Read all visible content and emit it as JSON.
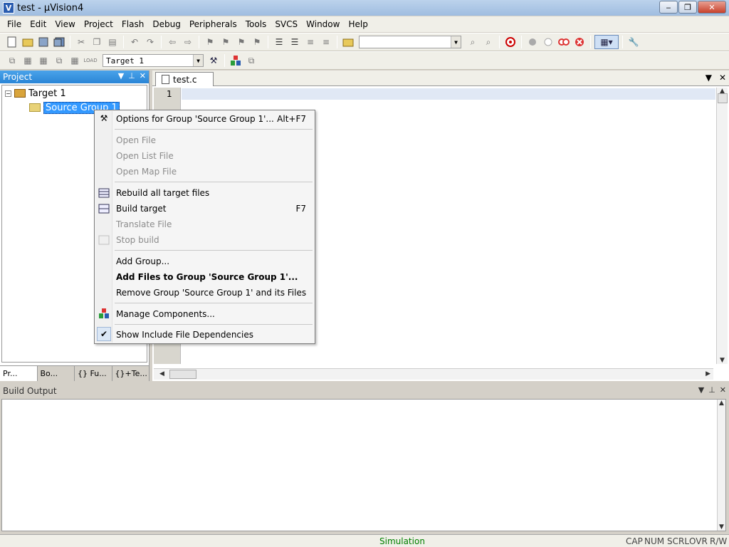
{
  "window": {
    "title": "test  - µVision4",
    "app_icon": "V",
    "minimize": "‒",
    "maximize": "❐",
    "close": "✕"
  },
  "menubar": [
    "File",
    "Edit",
    "View",
    "Project",
    "Flash",
    "Debug",
    "Peripherals",
    "Tools",
    "SVCS",
    "Window",
    "Help"
  ],
  "toolbar2": {
    "target_combo": "Target 1"
  },
  "project_panel": {
    "title": "Project",
    "tree": {
      "root": "Target 1",
      "child": "Source Group 1"
    },
    "tabs": [
      "Pr...",
      "Bo...",
      "{} Fu...",
      "{}+Te..."
    ]
  },
  "editor": {
    "tab": "test.c",
    "line_number": "1"
  },
  "context_menu": {
    "items": [
      {
        "label": "Options for Group 'Source Group 1'...",
        "shortcut": "Alt+F7"
      },
      {
        "label": "Open File"
      },
      {
        "label": "Open List File"
      },
      {
        "label": "Open Map File"
      },
      {
        "label": "Rebuild all target files"
      },
      {
        "label": "Build target",
        "shortcut": "F7"
      },
      {
        "label": "Translate File"
      },
      {
        "label": "Stop build"
      },
      {
        "label": "Add Group..."
      },
      {
        "label": "Add Files to Group 'Source Group 1'..."
      },
      {
        "label": "Remove Group 'Source Group 1' and its Files"
      },
      {
        "label": "Manage Components..."
      },
      {
        "label": "Show Include File Dependencies"
      }
    ]
  },
  "build_output": {
    "title": "Build Output"
  },
  "statusbar": {
    "mode": "Simulation",
    "cap": "CAP",
    "num": "NUM",
    "scrl": "SCRL",
    "ovr": "OVR",
    "rw": "R/W"
  },
  "colors": {
    "accent": "#3399ff",
    "simulation": "#008000",
    "panel_header": "#2a85d6"
  }
}
